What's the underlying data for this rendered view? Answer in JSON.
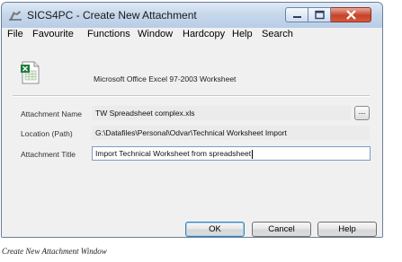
{
  "window": {
    "title": "SICS4PC - Create New Attachment",
    "controls": {
      "minimize_icon": "minimize-icon",
      "maximize_icon": "maximize-icon",
      "close_icon": "close-icon"
    }
  },
  "menu": {
    "items": [
      {
        "label": "File"
      },
      {
        "label": "Favourite"
      },
      {
        "label": "Functions"
      },
      {
        "label": "Window"
      },
      {
        "label": "Hardcopy"
      },
      {
        "label": "Help"
      },
      {
        "label": "Search"
      }
    ]
  },
  "attachment": {
    "file_type": "Microsoft Office Excel 97-2003 Worksheet",
    "file_icon": "excel-file-icon",
    "name_label": "Attachment Name",
    "name_value": "TW Spreadsheet complex.xls",
    "browse_label": "...",
    "location_label": "Location (Path)",
    "location_value": "G:\\Datafiles\\Personal\\Odvar\\Technical Worksheet Import",
    "title_label": "Attachment Title",
    "title_value": "Import Technical Worksheet from spreadsheet"
  },
  "buttons": {
    "ok": "OK",
    "cancel": "Cancel",
    "help": "Help"
  },
  "caption": "Create New Attachment Window",
  "colors": {
    "titlebar": "#c7d8ec",
    "close": "#c7422a",
    "dialog_bg": "#f0f0f0",
    "edit_border": "#7a9cc6"
  }
}
